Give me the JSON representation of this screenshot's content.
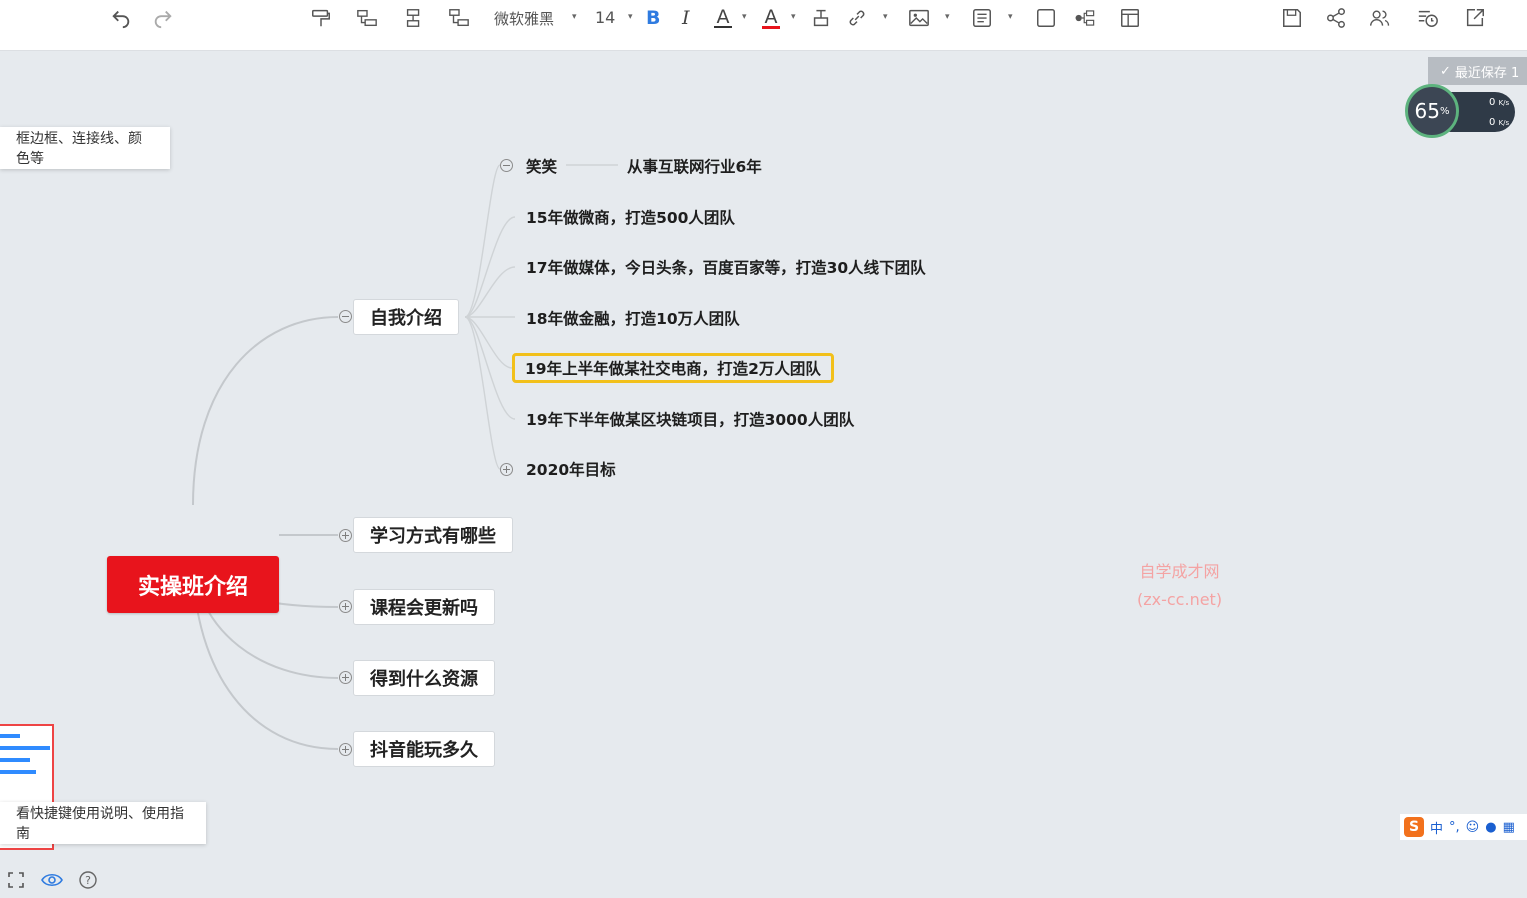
{
  "toolbar": {
    "font_name": "微软雅黑",
    "font_size": "14",
    "bold": "B",
    "italic": "I",
    "text_color": "A",
    "highlight": "A"
  },
  "mindmap": {
    "root": "实操班介绍",
    "branches": [
      {
        "label": "自我介绍"
      },
      {
        "label": "学习方式有哪些"
      },
      {
        "label": "课程会更新吗"
      },
      {
        "label": "得到什么资源"
      },
      {
        "label": "抖音能玩多久"
      }
    ],
    "intro_children": [
      {
        "label": "笑笑",
        "note": "从事互联网行业6年"
      },
      {
        "label": "15年做微商，打造500人团队"
      },
      {
        "label": "17年做媒体，今日头条，百度百家等，打造30人线下团队"
      },
      {
        "label": "18年做金融，打造10万人团队"
      },
      {
        "label": "19年上半年做某社交电商，打造2万人团队"
      },
      {
        "label": "19年下半年做某区块链项目，打造3000人团队"
      },
      {
        "label": "2020年目标"
      }
    ]
  },
  "tooltips": {
    "top": "框边框、连接线、颜色等",
    "bottom": "看快捷键使用说明、使用指南"
  },
  "watermark": {
    "line1": "自学成才网",
    "line2": "(zx-cc.net)"
  },
  "status": {
    "save": "最近保存 1",
    "percent": "65",
    "percent_unit": "%",
    "upload": "0",
    "download": "0",
    "rate_unit": "K/s"
  },
  "ime": {
    "logo": "S",
    "lang": "中"
  },
  "colors": {
    "root": "#e8141c",
    "selected": "#f2c01a",
    "canvas": "#e6eaee"
  }
}
